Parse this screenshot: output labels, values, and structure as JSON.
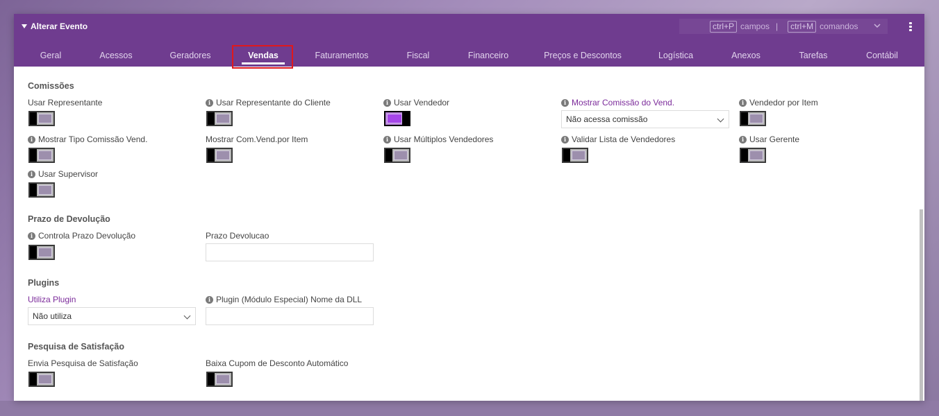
{
  "window": {
    "title": "Alterar Evento"
  },
  "shortcuts": {
    "fields_key": "ctrl+P",
    "fields_label": "campos",
    "separator": "|",
    "commands_key": "ctrl+M",
    "commands_label": "comandos"
  },
  "tabs": [
    {
      "label": "Geral"
    },
    {
      "label": "Acessos"
    },
    {
      "label": "Geradores"
    },
    {
      "label": "Vendas",
      "active": true
    },
    {
      "label": "Faturamentos"
    },
    {
      "label": "Fiscal"
    },
    {
      "label": "Financeiro"
    },
    {
      "label": "Preços e Descontos"
    },
    {
      "label": "Logística"
    },
    {
      "label": "Anexos"
    },
    {
      "label": "Tarefas"
    },
    {
      "label": "Contábil"
    }
  ],
  "sections": {
    "comissoes": {
      "title": "Comissões",
      "usar_representante": {
        "label": "Usar Representante",
        "checked": false
      },
      "usar_representante_cliente": {
        "label": "Usar Representante do Cliente",
        "checked": false
      },
      "usar_vendedor": {
        "label": "Usar Vendedor",
        "checked": true
      },
      "mostrar_comissao_vend": {
        "label": "Mostrar Comissão do Vend.",
        "value": "Não acessa comissão"
      },
      "vendedor_por_item": {
        "label": "Vendedor por Item",
        "checked": false
      },
      "mostrar_tipo_comissao": {
        "label": "Mostrar Tipo Comissão Vend.",
        "checked": false
      },
      "mostrar_com_vend_item": {
        "label": "Mostrar Com.Vend.por Item",
        "checked": false
      },
      "usar_multiplos_vendedores": {
        "label": "Usar Múltiplos Vendedores",
        "checked": false
      },
      "validar_lista_vendedores": {
        "label": "Validar Lista de Vendedores",
        "checked": false
      },
      "usar_gerente": {
        "label": "Usar Gerente",
        "checked": false
      },
      "usar_supervisor": {
        "label": "Usar Supervisor",
        "checked": false
      }
    },
    "prazo_devolucao": {
      "title": "Prazo de Devolução",
      "controla_prazo": {
        "label": "Controla Prazo Devolução",
        "checked": false
      },
      "prazo": {
        "label": "Prazo Devolucao",
        "value": ""
      }
    },
    "plugins": {
      "title": "Plugins",
      "utiliza_plugin": {
        "label": "Utiliza Plugin",
        "value": "Não utiliza"
      },
      "plugin_dll": {
        "label": "Plugin (Módulo Especial) Nome da DLL",
        "value": ""
      }
    },
    "pesquisa": {
      "title": "Pesquisa de Satisfação",
      "envia_pesquisa": {
        "label": "Envia Pesquisa de Satisfação",
        "checked": false
      },
      "baixa_cupom": {
        "label": "Baixa Cupom de Desconto Automático",
        "checked": false
      }
    }
  },
  "colors": {
    "header": "#6f3c8f",
    "accent": "#a646e8",
    "link": "#7b2a9a",
    "highlight": "#e0181c"
  }
}
